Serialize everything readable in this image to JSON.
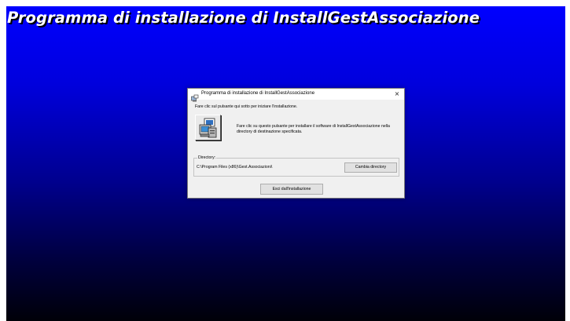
{
  "screen": {
    "banner_title": "Programma di installazione di InstallGestAssociazione",
    "background_colors": [
      "#0000ff",
      "#000008"
    ]
  },
  "dialog": {
    "title": "Programma di installazione di InstallGestAssociazione",
    "close_symbol": "×",
    "app_icon": "setup-icon",
    "instruction": "Fare clic sul pulsante qui sotto per iniziare l'installazione.",
    "install_button_icon": "computer-setup-icon",
    "install_description": "Fare clic su questo pulsante per installare il software di InstallGestAssociazione nella directory di destinazione specificata.",
    "directory_label": "Directory:",
    "directory_value": "C:\\Program Files (x86)\\Gest.Associazioni\\",
    "change_directory_label": "Cambia directory",
    "exit_label": "Esci dall'installazione"
  }
}
